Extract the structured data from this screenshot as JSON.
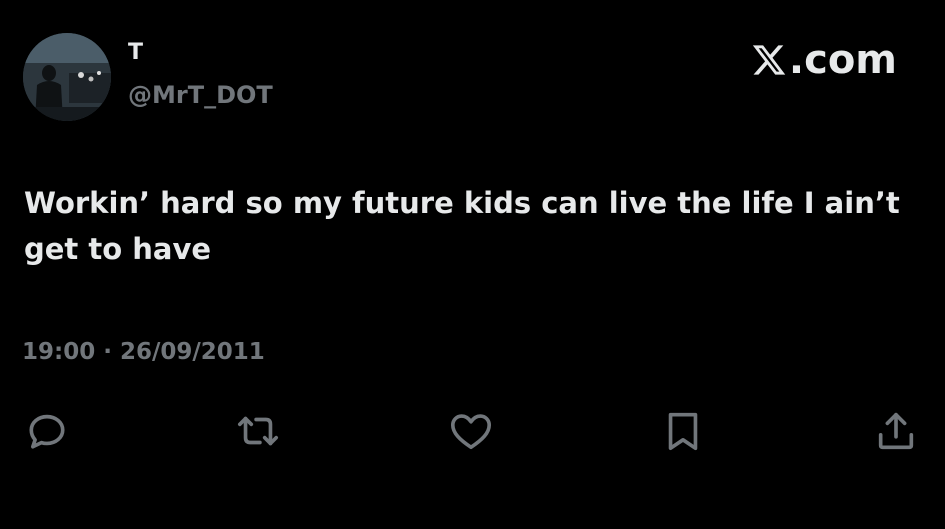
{
  "tweet": {
    "author": {
      "display_name": "T",
      "handle": "@MrT_DOT",
      "avatar": "avatar-photo"
    },
    "brand": {
      "icon": "x-logo-icon",
      "label": ".com"
    },
    "text": "Workin’ hard so my future kids can live the life I ain’t get to have",
    "timestamp": "19:00 · 26/09/2011",
    "actions": [
      {
        "icon": "reply-icon"
      },
      {
        "icon": "retweet-icon"
      },
      {
        "icon": "like-icon"
      },
      {
        "icon": "bookmark-icon"
      },
      {
        "icon": "share-icon"
      }
    ]
  },
  "colors": {
    "background": "#000000",
    "primary_text": "#e7e9ea",
    "secondary_text": "#71767b"
  }
}
